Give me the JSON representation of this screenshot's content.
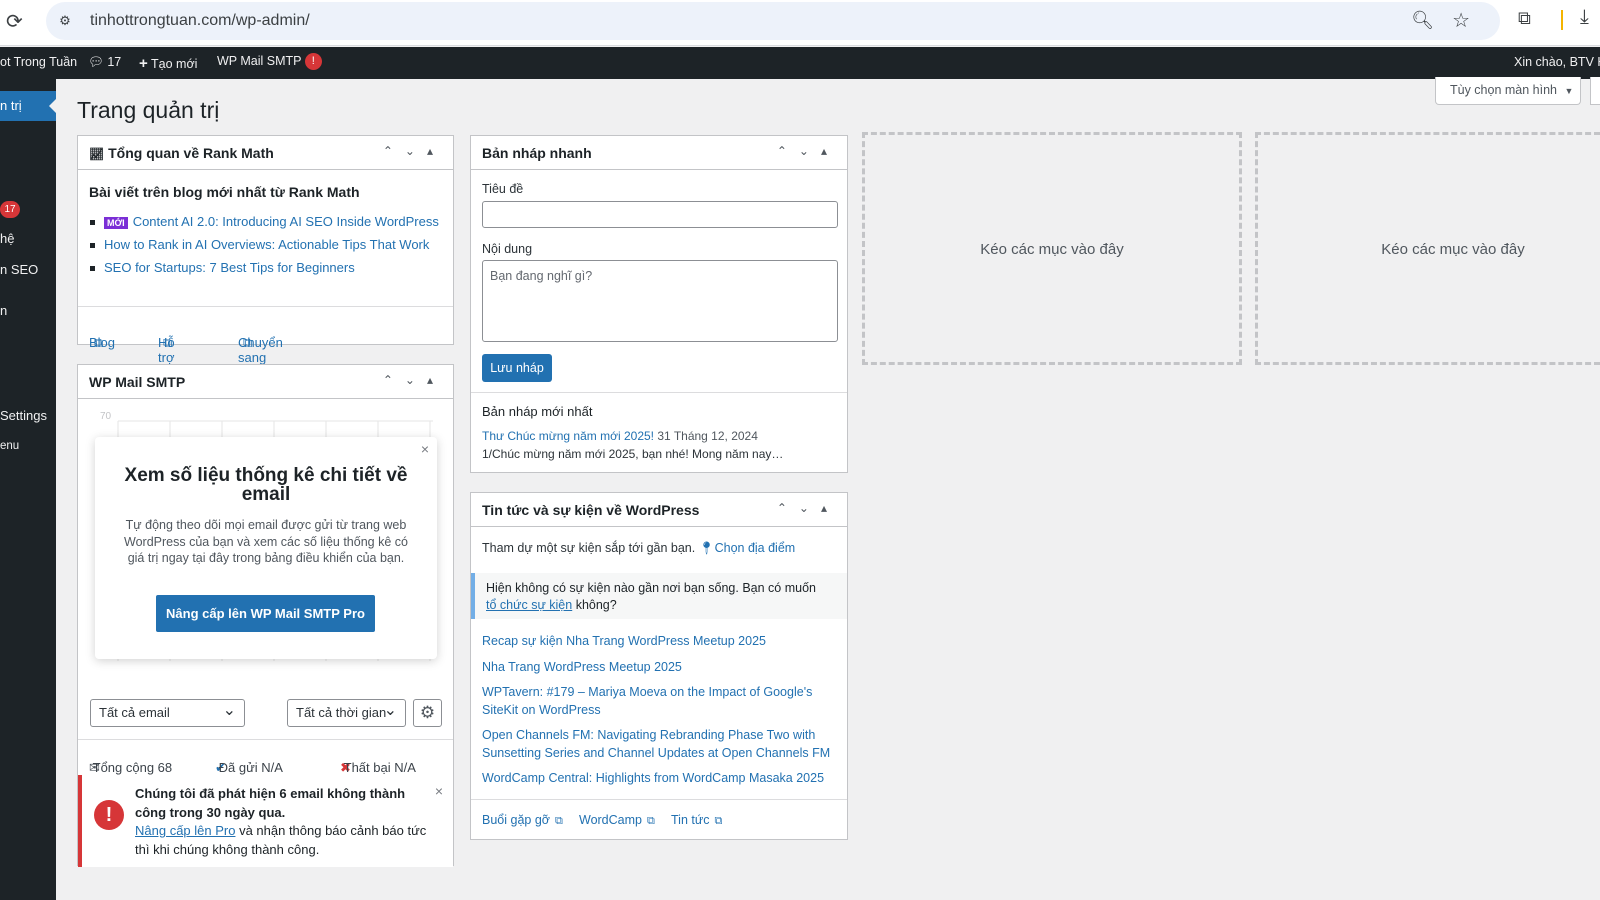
{
  "browser": {
    "url": "tinhottrongtuan.com/wp-admin/"
  },
  "adminbar": {
    "site_name": "ot Trong Tuần",
    "comments_count": "17",
    "new_label": "Tạo mới",
    "smtp_label": "WP Mail SMTP",
    "smtp_badge": "!",
    "greeting": "Xin chào, BTV H"
  },
  "sidebar": {
    "active": "n trị",
    "badge": "17",
    "items": [
      "hệ",
      "n SEO",
      "n",
      "Settings",
      "enu"
    ]
  },
  "page": {
    "title": "Trang quản trị",
    "screen_options": "Tùy chọn màn hình"
  },
  "rankmath": {
    "title": "Tổng quan về Rank Math",
    "subtitle": "Bài viết trên blog mới nhất từ Rank Math",
    "new_tag": "MỚI",
    "posts": [
      "Content AI 2.0: Introducing AI SEO Inside WordPress",
      "How to Rank in AI Overviews: Actionable Tips That Work",
      "SEO for Startups: 7 Best Tips for Beginners"
    ],
    "footer": {
      "blog": "Blog",
      "support": "Hỗ trợ",
      "pro": "Chuyển sang Pro"
    }
  },
  "smtp": {
    "title": "WP Mail SMTP",
    "chart_ymax_label": "70",
    "popup_title": "Xem số liệu thống kê chi tiết về email",
    "popup_text": "Tự động theo dõi mọi email được gửi từ trang web WordPress của bạn và xem các số liệu thống kê có giá trị ngay tại đây trong bảng điều khiển của bạn.",
    "popup_button": "Nâng cấp lên WP Mail SMTP Pro",
    "select_email": "Tất cả email",
    "select_time": "Tất cả thời gian",
    "stats": {
      "total": "Tổng cộng 68",
      "sent": "Đã gửi N/A",
      "failed": "Thất bại N/A"
    },
    "alert_bold": "Chúng tôi đã phát hiện 6 email không thành công trong 30 ngày qua.",
    "alert_link": "Nâng cấp lên Pro",
    "alert_rest": " và nhận thông báo cảnh báo tức thì khi chúng không thành công."
  },
  "draft": {
    "title": "Bản nháp nhanh",
    "title_label": "Tiêu đề",
    "content_label": "Nội dung",
    "content_placeholder": "Bạn đang nghĩ gì?",
    "save": "Lưu nháp",
    "recent_heading": "Bản nháp mới nhất",
    "recent_link": "Thư Chúc mừng năm mới 2025!",
    "recent_date": "31 Tháng 12, 2024",
    "recent_excerpt": "1/Chúc mừng năm mới 2025, bạn nhé! Mong năm nay…"
  },
  "news": {
    "title": "Tin tức và sự kiện về WordPress",
    "intro": "Tham dự một sự kiện sắp tới gần bạn.",
    "choose_location": "Chọn địa điểm",
    "notice_pre": "Hiện không có sự kiện nào gần nơi bạn sống. Bạn có muốn ",
    "notice_link": "tổ chức sự kiện",
    "notice_post": " không?",
    "links": [
      "Recap sự kiện Nha Trang WordPress Meetup 2025",
      "Nha Trang WordPress Meetup 2025",
      "WPTavern: #179 – Mariya Moeva on the Impact of Google's SiteKit on WordPress",
      "Open Channels FM: Navigating Rebranding Phase Two with Sunsetting Series and Channel Updates at Open Channels FM",
      "WordCamp Central: Highlights from WordCamp Masaka 2025"
    ],
    "footer": {
      "meetups": "Buổi gặp gỡ",
      "wordcamp": "WordCamp",
      "news": "Tin tức"
    }
  },
  "dropzone": {
    "label": "Kéo các mục vào đây"
  }
}
